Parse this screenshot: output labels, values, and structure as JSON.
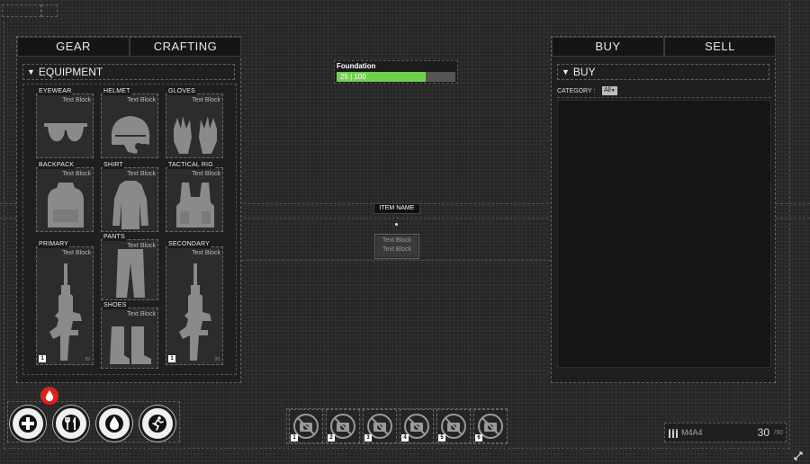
{
  "left_panel": {
    "tabs": [
      {
        "label": "GEAR"
      },
      {
        "label": "CRAFTING"
      }
    ],
    "section_title": "EQUIPMENT",
    "slots": {
      "eyewear": {
        "label": "EYEWEAR",
        "text": "Text Block"
      },
      "helmet": {
        "label": "HELMET",
        "text": "Text Block"
      },
      "gloves": {
        "label": "GLOVES",
        "text": "Text Block"
      },
      "backpack": {
        "label": "BACKPACK",
        "text": "Text Block"
      },
      "shirt": {
        "label": "SHIRT",
        "text": "Text Block"
      },
      "tactical_rig": {
        "label": "TACTICAL RIG",
        "text": "Text Block"
      },
      "primary": {
        "label": "PRIMARY",
        "text": "Text Block",
        "slot_number": "1",
        "ammo": "99"
      },
      "pants": {
        "label": "PANTS",
        "text": "Text Block"
      },
      "secondary": {
        "label": "SECONDARY",
        "text": "Text Block",
        "slot_number": "1",
        "ammo": "99"
      },
      "shoes": {
        "label": "SHOES",
        "text": "Text Block"
      }
    }
  },
  "foundation": {
    "title": "Foundation",
    "value_text": "25 | 100",
    "fraction": 0.75
  },
  "center": {
    "item_name": "ITEM NAME",
    "text_block_1": "Text Block",
    "text_block_2": "Text Block"
  },
  "right_panel": {
    "tabs": [
      {
        "label": "BUY"
      },
      {
        "label": "SELL"
      }
    ],
    "section_title": "BUY",
    "category_label": "CATEGORY :",
    "category_value": "All"
  },
  "hud": {
    "stats": [
      {
        "icon": "health-plus-icon"
      },
      {
        "icon": "food-fork-knife-icon"
      },
      {
        "icon": "water-drop-icon"
      },
      {
        "icon": "stamina-running-icon"
      }
    ],
    "alert_icon": "blood-drop-icon",
    "hotbar": [
      {
        "number": "1"
      },
      {
        "number": "2"
      },
      {
        "number": "3"
      },
      {
        "number": "4"
      },
      {
        "number": "5"
      },
      {
        "number": "6"
      }
    ],
    "weapon": {
      "name": "M4A4",
      "ammo": "30",
      "reserve": "/90"
    }
  },
  "colors": {
    "progress": "#6fd14a",
    "alert": "#e0201c"
  }
}
